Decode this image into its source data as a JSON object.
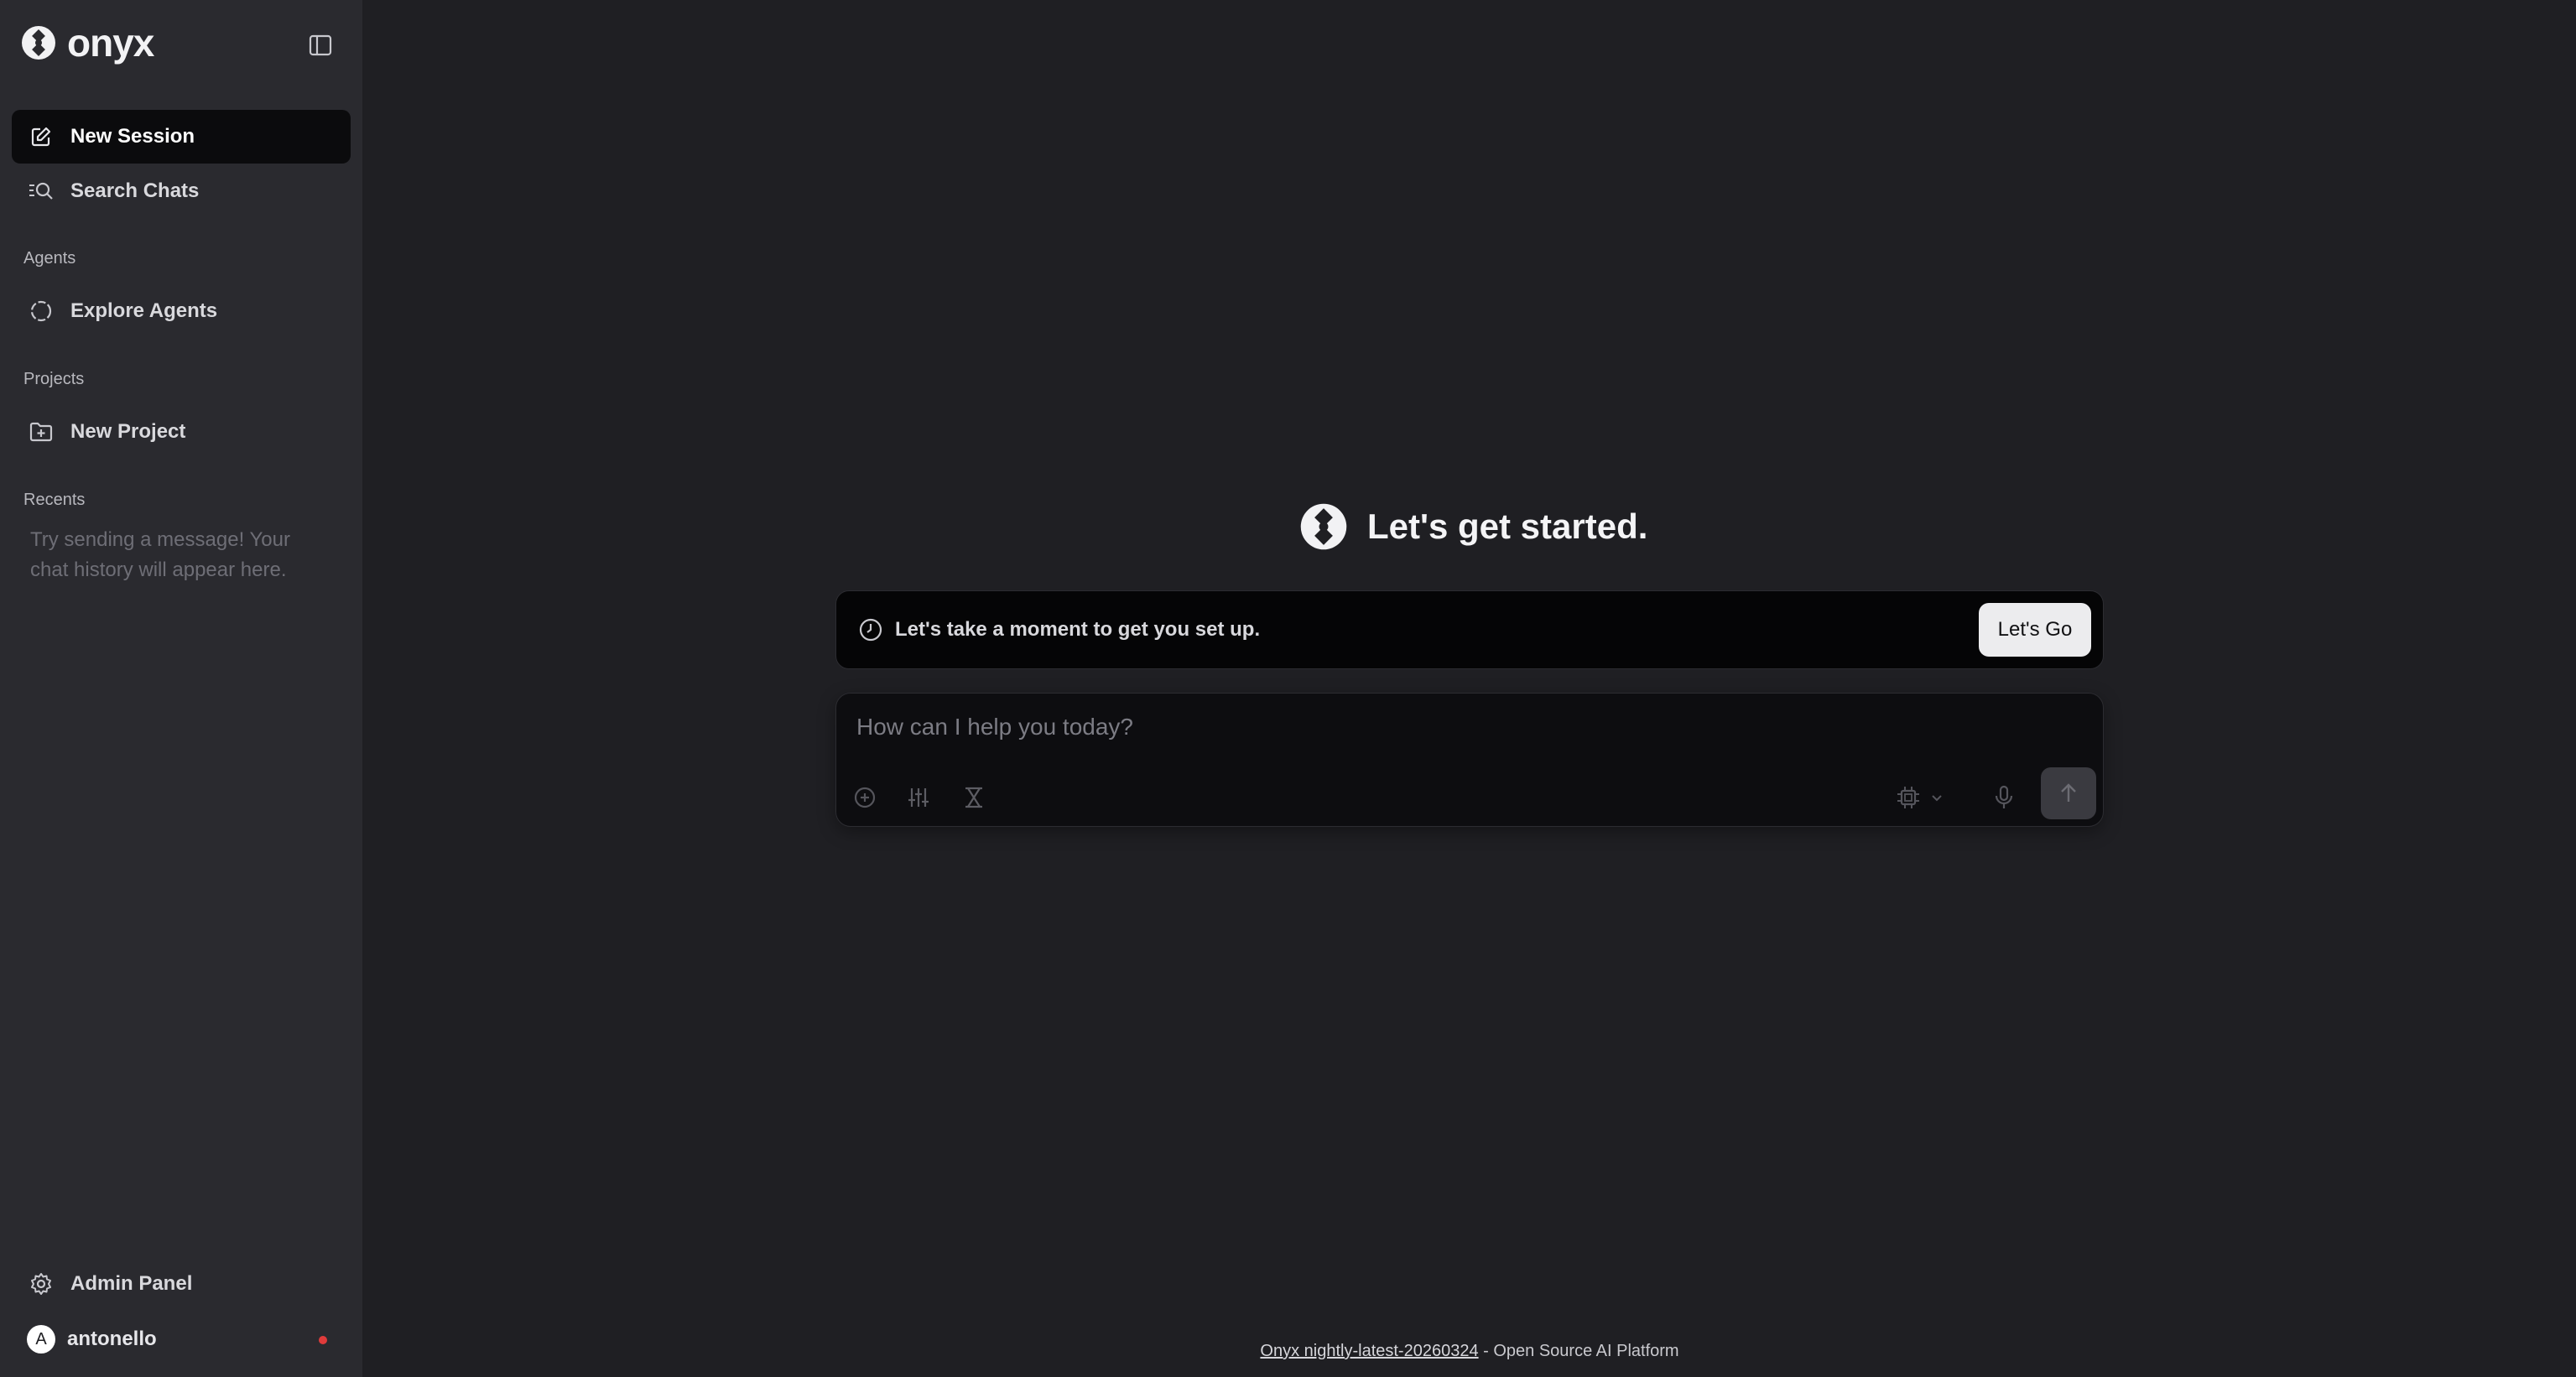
{
  "brand": {
    "name": "onyx"
  },
  "sidebar": {
    "nav": {
      "new_session": "New Session",
      "search_chats": "Search Chats"
    },
    "sections": {
      "agents": "Agents",
      "projects": "Projects",
      "recents": "Recents"
    },
    "explore_agents": "Explore Agents",
    "new_project": "New Project",
    "recents_empty": "Try sending a message! Your chat history will appear here.",
    "admin_panel": "Admin Panel",
    "user": {
      "initial": "A",
      "name": "antonello"
    }
  },
  "main": {
    "hero_title": "Let's get started.",
    "setup": {
      "text": "Let's take a moment to get you set up.",
      "button": "Let's Go"
    },
    "composer": {
      "placeholder": "How can I help you today?"
    }
  },
  "footer": {
    "version_link": "Onyx nightly-latest-20260324",
    "suffix": " - Open Source AI Platform"
  },
  "icons": {
    "brand_logo": "onyx-logo-icon",
    "collapse": "sidebar-toggle-icon",
    "new_session": "edit-icon",
    "search": "search-icon",
    "agents": "agents-circle-icon",
    "project": "folder-plus-icon",
    "settings": "gear-icon",
    "attach": "plus-circle-icon",
    "options": "sliders-icon",
    "timer": "hourglass-icon",
    "model": "chip-icon",
    "chevron": "chevron-down-icon",
    "mic": "microphone-icon",
    "send": "arrow-up-icon",
    "info": "clock-icon"
  },
  "colors": {
    "accent_dot": "#e03b3b",
    "sidebar_bg": "#2a2a2f",
    "main_bg": "#1f1f23"
  }
}
